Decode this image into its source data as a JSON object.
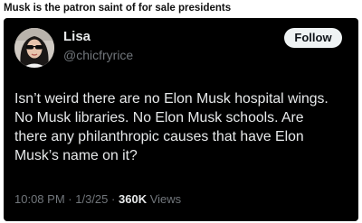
{
  "caption": "Musk is the patron saint of for sale presidents",
  "tweet": {
    "author_name": "Lisa",
    "author_handle": "@chicfryrice",
    "follow_label": "Follow",
    "text_lines": [
      "Isn’t weird there are no Elon Musk hospital wings.",
      "No Musk libraries. No Elon Musk schools. Are",
      "there any philanthropic causes that have Elon",
      "Musk’s name on it?"
    ],
    "time": "10:08 PM",
    "separator": "·",
    "date": "1/3/25",
    "views_count": "360K",
    "views_label": "Views"
  },
  "colors": {
    "card_background": "#000000",
    "primary_text": "#e7e9ea",
    "secondary_text": "#71767b",
    "follow_button_bg": "#eff3f4"
  }
}
